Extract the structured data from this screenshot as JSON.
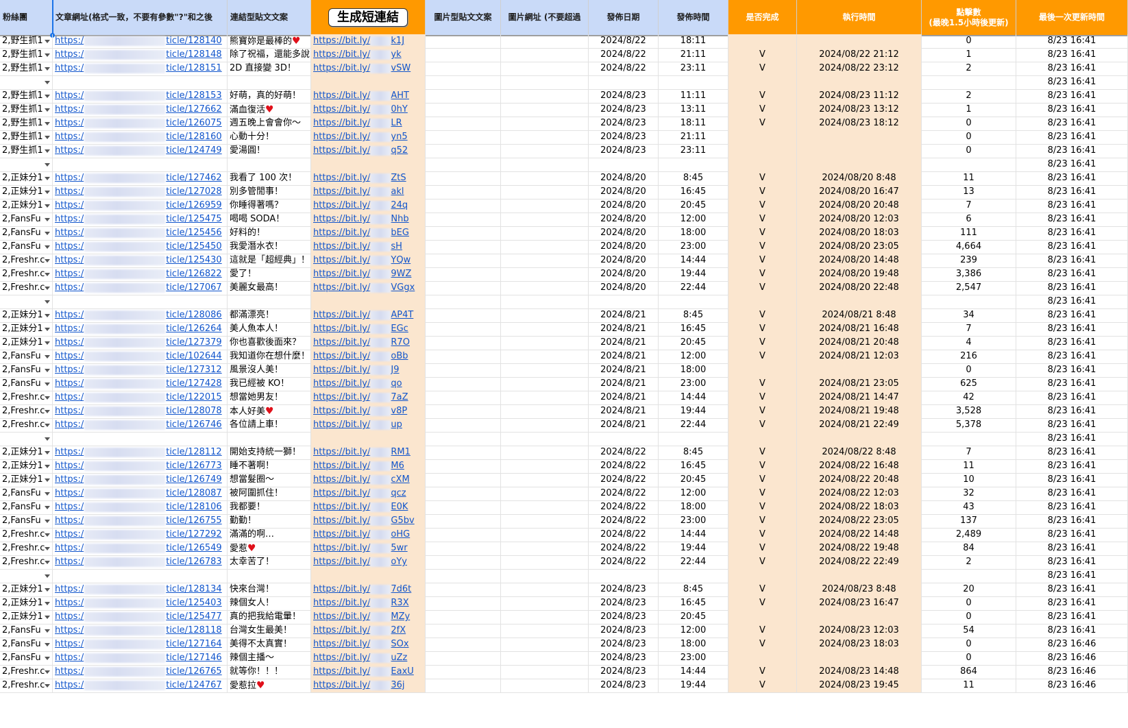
{
  "header": {
    "fan_group": "粉絲團",
    "article_url": "文章網址(格式一致，不要有參數\"?\"和之後",
    "link_post_text": "連結型貼文文案",
    "generate_button": "生成短連結",
    "image_post_text": "圖片型貼文文案",
    "image_url": "圖片網址 (不要超過",
    "post_date": "發佈日期",
    "post_time": "發佈時間",
    "is_done": "是否完成",
    "exec_time": "執行時間",
    "clicks_line1": "點擊數",
    "clicks_line2": "(最晚1.5小時後更新)",
    "last_update": "最後一次更新時間"
  },
  "url_prefix": "https:/",
  "short_prefix": "https://bit.ly/",
  "rows": [
    {
      "group": "2,野生抓1",
      "art": "ticle/128140",
      "text": "熊寶妳是最棒的",
      "heart": true,
      "short": "k1J",
      "date": "2024/8/22",
      "time": "18:11",
      "done": "",
      "exec": "",
      "clicks": "0",
      "updated": "8/23 16:41"
    },
    {
      "group": "2,野生抓1",
      "art": "ticle/128148",
      "text": "除了祝福，還能多說",
      "short": "yk",
      "date": "2024/8/22",
      "time": "21:11",
      "done": "V",
      "exec": "2024/08/22 21:12",
      "clicks": "1",
      "updated": "8/23 16:41"
    },
    {
      "group": "2,野生抓1",
      "art": "ticle/128151",
      "text": "2D 直接變 3D！",
      "short": "vSW",
      "date": "2024/8/22",
      "time": "23:11",
      "done": "V",
      "exec": "2024/08/22 23:12",
      "clicks": "2",
      "updated": "8/23 16:41"
    },
    {
      "blank": true,
      "updated": "8/23 16:41"
    },
    {
      "group": "2,野生抓1",
      "art": "ticle/128153",
      "text": "好萌，真的好萌！",
      "short": "AHT",
      "date": "2024/8/23",
      "time": "11:11",
      "done": "V",
      "exec": "2024/08/23 11:12",
      "clicks": "2",
      "updated": "8/23 16:41"
    },
    {
      "group": "2,野生抓1",
      "art": "ticle/127662",
      "text": "滿血復活",
      "heart": true,
      "short": "0hY",
      "date": "2024/8/23",
      "time": "13:11",
      "done": "V",
      "exec": "2024/08/23 13:12",
      "clicks": "1",
      "updated": "8/23 16:41"
    },
    {
      "group": "2,野生抓1",
      "art": "ticle/126075",
      "text": "週五晚上會會你～",
      "short": "LR",
      "date": "2024/8/23",
      "time": "18:11",
      "done": "V",
      "exec": "2024/08/23 18:12",
      "clicks": "0",
      "updated": "8/23 16:41"
    },
    {
      "group": "2,野生抓1",
      "art": "ticle/128160",
      "text": "心動十分！",
      "short": "yn5",
      "date": "2024/8/23",
      "time": "21:11",
      "done": "",
      "exec": "",
      "clicks": "0",
      "updated": "8/23 16:41"
    },
    {
      "group": "2,野生抓1",
      "art": "ticle/124749",
      "text": "愛湯圓！",
      "short": "q52",
      "date": "2024/8/23",
      "time": "23:11",
      "done": "",
      "exec": "",
      "clicks": "0",
      "updated": "8/23 16:41"
    },
    {
      "blank": true,
      "updated": "8/23 16:41"
    },
    {
      "group": "2,正妹分1",
      "art": "ticle/127462",
      "text": "我看了 100 次！",
      "short": "ZtS",
      "date": "2024/8/20",
      "time": "8:45",
      "done": "V",
      "exec": "2024/08/20 8:48",
      "clicks": "11",
      "updated": "8/23 16:41"
    },
    {
      "group": "2,正妹分1",
      "art": "ticle/127028",
      "text": "別多管閒事！",
      "short": "akl",
      "date": "2024/8/20",
      "time": "16:45",
      "done": "V",
      "exec": "2024/08/20 16:47",
      "clicks": "13",
      "updated": "8/23 16:41"
    },
    {
      "group": "2,正妹分1",
      "art": "ticle/126959",
      "text": "你睡得著嗎？",
      "short": "24q",
      "date": "2024/8/20",
      "time": "20:45",
      "done": "V",
      "exec": "2024/08/20 20:48",
      "clicks": "7",
      "updated": "8/23 16:41"
    },
    {
      "group": "2,FansFu",
      "art": "ticle/125475",
      "text": "喝喝 SODA！",
      "short": "Nhb",
      "date": "2024/8/20",
      "time": "12:00",
      "done": "V",
      "exec": "2024/08/20 12:03",
      "clicks": "6",
      "updated": "8/23 16:41"
    },
    {
      "group": "2,FansFu",
      "art": "ticle/125456",
      "text": "好料的！",
      "short": "bEG",
      "date": "2024/8/20",
      "time": "18:00",
      "done": "V",
      "exec": "2024/08/20 18:03",
      "clicks": "111",
      "updated": "8/23 16:41"
    },
    {
      "group": "2,FansFu",
      "art": "ticle/125450",
      "text": "我愛潛水衣！",
      "short": "sH",
      "date": "2024/8/20",
      "time": "23:00",
      "done": "V",
      "exec": "2024/08/20 23:05",
      "clicks": "4,664",
      "updated": "8/23 16:41"
    },
    {
      "group": "2,Freshr.c",
      "art": "ticle/125430",
      "text": "這就是「超經典」！",
      "short": "YQw",
      "date": "2024/8/20",
      "time": "14:44",
      "done": "V",
      "exec": "2024/08/20 14:48",
      "clicks": "239",
      "updated": "8/23 16:41"
    },
    {
      "group": "2,Freshr.c",
      "art": "ticle/126822",
      "text": "愛了！",
      "short": "9WZ",
      "date": "2024/8/20",
      "time": "19:44",
      "done": "V",
      "exec": "2024/08/20 19:48",
      "clicks": "3,386",
      "updated": "8/23 16:41"
    },
    {
      "group": "2,Freshr.c",
      "art": "ticle/127067",
      "text": "美麗女最高！",
      "short": "VGgx",
      "date": "2024/8/20",
      "time": "22:44",
      "done": "V",
      "exec": "2024/08/20 22:48",
      "clicks": "2,547",
      "updated": "8/23 16:41"
    },
    {
      "blank": true,
      "updated": "8/23 16:41"
    },
    {
      "group": "2,正妹分1",
      "art": "ticle/128086",
      "text": "都滿漂亮！",
      "short": "AP4T",
      "date": "2024/8/21",
      "time": "8:45",
      "done": "V",
      "exec": "2024/08/21 8:48",
      "clicks": "34",
      "updated": "8/23 16:41"
    },
    {
      "group": "2,正妹分1",
      "art": "ticle/126264",
      "text": "美人魚本人！",
      "short": "EGc",
      "date": "2024/8/21",
      "time": "16:45",
      "done": "V",
      "exec": "2024/08/21 16:48",
      "clicks": "7",
      "updated": "8/23 16:41"
    },
    {
      "group": "2,正妹分1",
      "art": "ticle/127379",
      "text": "你也喜歡後面來？",
      "short": "R7O",
      "date": "2024/8/21",
      "time": "20:45",
      "done": "V",
      "exec": "2024/08/21 20:48",
      "clicks": "4",
      "updated": "8/23 16:41"
    },
    {
      "group": "2,FansFu",
      "art": "ticle/102644",
      "text": "我知道你在想什麼！",
      "short": "oBb",
      "date": "2024/8/21",
      "time": "12:00",
      "done": "V",
      "exec": "2024/08/21 12:03",
      "clicks": "216",
      "updated": "8/23 16:41"
    },
    {
      "group": "2,FansFu",
      "art": "ticle/127312",
      "text": "風景沒人美！",
      "short": "J9",
      "date": "2024/8/21",
      "time": "18:00",
      "done": "",
      "exec": "",
      "clicks": "0",
      "updated": "8/23 16:41"
    },
    {
      "group": "2,FansFu",
      "art": "ticle/127428",
      "text": "我已經被 KO！",
      "short": "qo",
      "date": "2024/8/21",
      "time": "23:00",
      "done": "V",
      "exec": "2024/08/21 23:05",
      "clicks": "625",
      "updated": "8/23 16:41"
    },
    {
      "group": "2,Freshr.c",
      "art": "ticle/122015",
      "text": "想當她男友！",
      "short": "7aZ",
      "date": "2024/8/21",
      "time": "14:44",
      "done": "V",
      "exec": "2024/08/21 14:47",
      "clicks": "42",
      "updated": "8/23 16:41"
    },
    {
      "group": "2,Freshr.c",
      "art": "ticle/128078",
      "text": "本人好美",
      "heart": true,
      "short": "v8P",
      "date": "2024/8/21",
      "time": "19:44",
      "done": "V",
      "exec": "2024/08/21 19:48",
      "clicks": "3,528",
      "updated": "8/23 16:41"
    },
    {
      "group": "2,Freshr.c",
      "art": "ticle/126746",
      "text": "各位請上車！",
      "short": "up",
      "date": "2024/8/21",
      "time": "22:44",
      "done": "V",
      "exec": "2024/08/21 22:49",
      "clicks": "5,378",
      "updated": "8/23 16:41"
    },
    {
      "blank": true,
      "updated": "8/23 16:41"
    },
    {
      "group": "2,正妹分1",
      "art": "ticle/128112",
      "text": "開始支持統一獅！",
      "short": "RM1",
      "date": "2024/8/22",
      "time": "8:45",
      "done": "V",
      "exec": "2024/08/22 8:48",
      "clicks": "7",
      "updated": "8/23 16:41"
    },
    {
      "group": "2,正妹分1",
      "art": "ticle/126773",
      "text": "睡不著啊！",
      "short": "M6",
      "date": "2024/8/22",
      "time": "16:45",
      "done": "V",
      "exec": "2024/08/22 16:48",
      "clicks": "11",
      "updated": "8/23 16:41"
    },
    {
      "group": "2,正妹分1",
      "art": "ticle/126749",
      "text": "想當髮圈～",
      "short": "cXM",
      "date": "2024/8/22",
      "time": "20:45",
      "done": "V",
      "exec": "2024/08/22 20:48",
      "clicks": "10",
      "updated": "8/23 16:41"
    },
    {
      "group": "2,FansFu",
      "art": "ticle/128087",
      "text": "被阿圍抓住！",
      "short": "qcz",
      "date": "2024/8/22",
      "time": "12:00",
      "done": "V",
      "exec": "2024/08/22 12:03",
      "clicks": "32",
      "updated": "8/23 16:41"
    },
    {
      "group": "2,FansFu",
      "art": "ticle/128106",
      "text": "我都要！",
      "short": "E0K",
      "date": "2024/8/22",
      "time": "18:00",
      "done": "V",
      "exec": "2024/08/22 18:03",
      "clicks": "43",
      "updated": "8/23 16:41"
    },
    {
      "group": "2,FansFu",
      "art": "ticle/126755",
      "text": "勤勤！",
      "short": "G5bv",
      "date": "2024/8/22",
      "time": "23:00",
      "done": "V",
      "exec": "2024/08/22 23:05",
      "clicks": "137",
      "updated": "8/23 16:41"
    },
    {
      "group": "2,Freshr.c",
      "art": "ticle/127292",
      "text": "滿滿的啊…",
      "short": "oHG",
      "date": "2024/8/22",
      "time": "14:44",
      "done": "V",
      "exec": "2024/08/22 14:48",
      "clicks": "2,489",
      "updated": "8/23 16:41"
    },
    {
      "group": "2,Freshr.c",
      "art": "ticle/126549",
      "text": "愛惹",
      "heart": true,
      "short": "5wr",
      "date": "2024/8/22",
      "time": "19:44",
      "done": "V",
      "exec": "2024/08/22 19:48",
      "clicks": "84",
      "updated": "8/23 16:41"
    },
    {
      "group": "2,Freshr.c",
      "art": "ticle/126783",
      "text": "太幸苦了！",
      "short": "oYy",
      "date": "2024/8/22",
      "time": "22:44",
      "done": "V",
      "exec": "2024/08/22 22:49",
      "clicks": "2",
      "updated": "8/23 16:41"
    },
    {
      "blank": true,
      "updated": "8/23 16:41"
    },
    {
      "group": "2,正妹分1",
      "art": "ticle/128134",
      "text": "快來台灣！",
      "short": "7d6t",
      "date": "2024/8/23",
      "time": "8:45",
      "done": "V",
      "exec": "2024/08/23 8:48",
      "clicks": "20",
      "updated": "8/23 16:41"
    },
    {
      "group": "2,正妹分1",
      "art": "ticle/125403",
      "text": "辣個女人！",
      "short": "R3X",
      "date": "2024/8/23",
      "time": "16:45",
      "done": "V",
      "exec": "2024/08/23 16:47",
      "clicks": "0",
      "updated": "8/23 16:41"
    },
    {
      "group": "2,正妹分1",
      "art": "ticle/125477",
      "text": "真的把我給電暈！",
      "short": "MZy",
      "date": "2024/8/23",
      "time": "20:45",
      "done": "",
      "exec": "",
      "clicks": "0",
      "updated": "8/23 16:41"
    },
    {
      "group": "2,FansFu",
      "art": "ticle/128118",
      "text": "台灣女生最美！",
      "short": "2fX",
      "date": "2024/8/23",
      "time": "12:00",
      "done": "V",
      "exec": "2024/08/23 12:03",
      "clicks": "54",
      "updated": "8/23 16:41"
    },
    {
      "group": "2,FansFu",
      "art": "ticle/127164",
      "text": "美得不太真實！",
      "short": "SOx",
      "date": "2024/8/23",
      "time": "18:00",
      "done": "V",
      "exec": "2024/08/23 18:03",
      "clicks": "0",
      "updated": "8/23 16:46"
    },
    {
      "group": "2,FansFu",
      "art": "ticle/127146",
      "text": "辣個主播～",
      "short": "uZz",
      "date": "2024/8/23",
      "time": "23:00",
      "done": "",
      "exec": "",
      "clicks": "0",
      "updated": "8/23 16:46"
    },
    {
      "group": "2,Freshr.c",
      "art": "ticle/126765",
      "text": "就等你！！！",
      "short": "EaxU",
      "date": "2024/8/23",
      "time": "14:44",
      "done": "V",
      "exec": "2024/08/23 14:48",
      "clicks": "864",
      "updated": "8/23 16:46"
    },
    {
      "group": "2,Freshr.c",
      "art": "ticle/124767",
      "text": "愛惹拉",
      "heart": true,
      "short": "36j",
      "date": "2024/8/23",
      "time": "19:44",
      "done": "V",
      "exec": "2024/08/23 19:45",
      "clicks": "11",
      "updated": "8/23 16:46"
    }
  ]
}
